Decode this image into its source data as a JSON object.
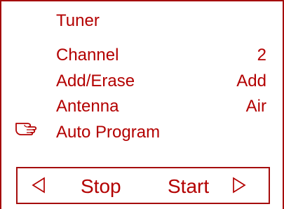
{
  "menu": {
    "title": "Tuner",
    "items": [
      {
        "label": "Channel",
        "value": "2"
      },
      {
        "label": "Add/Erase",
        "value": "Add"
      },
      {
        "label": "Antenna",
        "value": "Air"
      },
      {
        "label": "Auto Program",
        "value": ""
      }
    ],
    "selected_item": "Auto Program",
    "pointer_icon": "hand-pointer-icon"
  },
  "controls": {
    "left_icon": "left-triangle-icon",
    "stop_label": "Stop",
    "start_label": "Start",
    "right_icon": "right-triangle-icon"
  },
  "colors": {
    "text": "#b30000",
    "border": "#a50d0d",
    "background": "#ffffff"
  }
}
